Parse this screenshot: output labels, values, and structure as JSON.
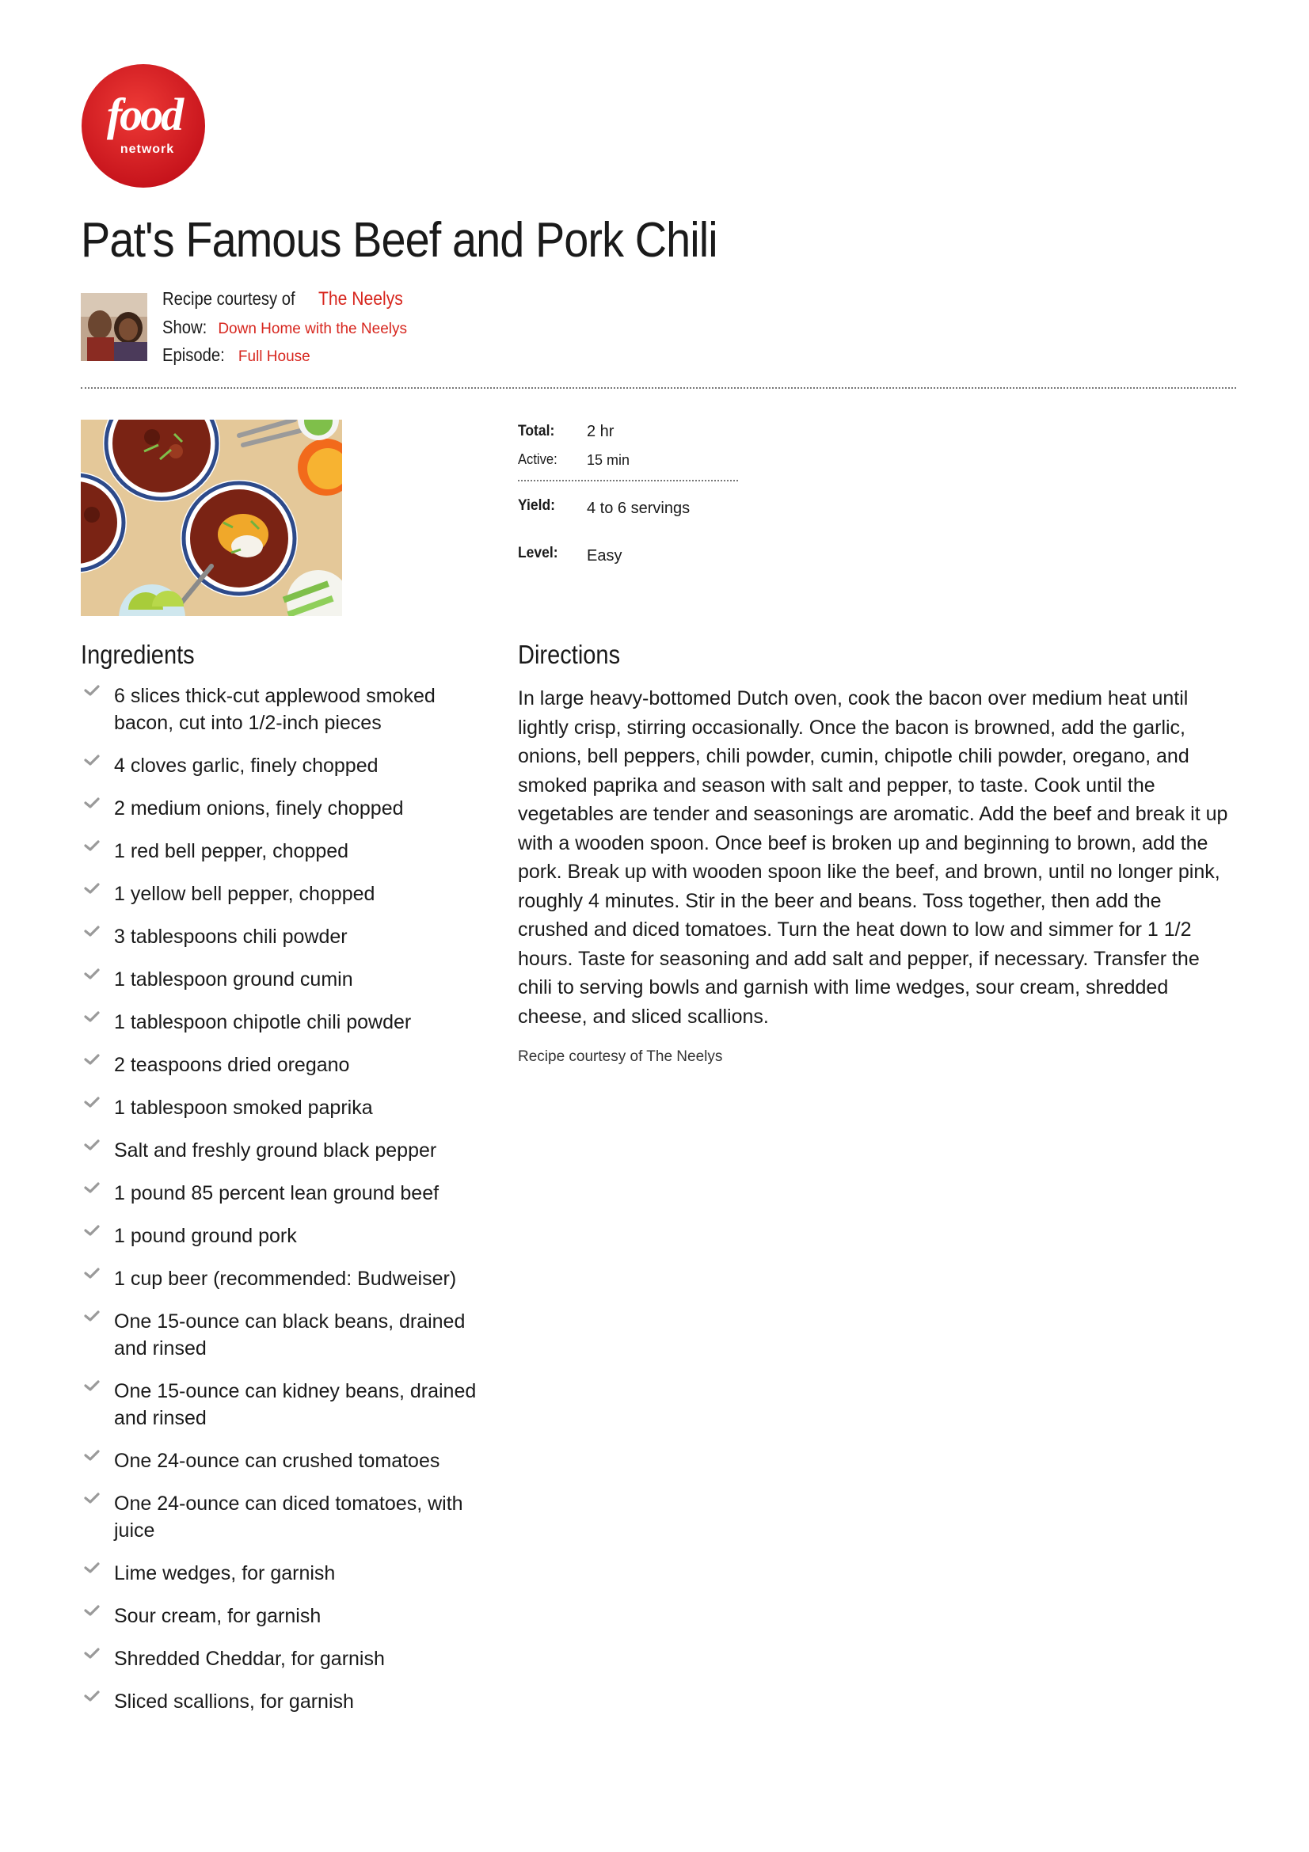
{
  "logo": {
    "brand": "food",
    "sub": "network",
    "color": "#d7261e"
  },
  "recipe": {
    "title": "Pat's Famous Beef and Pork Chili",
    "courtesy_label": "Recipe courtesy of",
    "courtesy_name": "The Neelys",
    "show_label": "Show:",
    "show_name": "Down Home with the Neelys",
    "episode_label": "Episode:",
    "episode_name": "Full House"
  },
  "meta": {
    "total_label": "Total:",
    "total_value": "2 hr",
    "active_label": "Active:",
    "active_value": "15 min",
    "yield_label": "Yield:",
    "yield_value": "4 to 6 servings",
    "level_label": "Level:",
    "level_value": "Easy"
  },
  "ingredients": {
    "heading": "Ingredients",
    "items": [
      "6 slices thick-cut applewood smoked bacon, cut into 1/2-inch pieces",
      "4 cloves garlic, finely chopped",
      "2 medium onions, finely chopped",
      "1 red bell pepper, chopped",
      "1 yellow bell pepper, chopped",
      "3 tablespoons chili powder",
      "1 tablespoon ground cumin",
      "1 tablespoon chipotle chili powder",
      "2 teaspoons dried oregano",
      "1 tablespoon smoked paprika",
      "Salt and freshly ground black pepper",
      "1 pound 85 percent lean ground beef",
      "1 pound ground pork",
      "1 cup beer (recommended: Budweiser)",
      "One 15-ounce can black beans, drained and rinsed",
      "One 15-ounce can kidney beans, drained and rinsed",
      "One 24-ounce can crushed tomatoes",
      "One 24-ounce can diced tomatoes, with juice",
      "Lime wedges, for garnish",
      "Sour cream, for garnish",
      "Shredded Cheddar, for garnish",
      "Sliced scallions, for garnish"
    ]
  },
  "directions": {
    "heading": "Directions",
    "text": "In large heavy-bottomed Dutch oven, cook the bacon over medium heat until lightly crisp, stirring occasionally. Once the bacon is browned, add the garlic, onions, bell peppers, chili powder, cumin, chipotle chili powder, oregano, and smoked paprika and season with salt and pepper, to taste. Cook until the vegetables are tender and seasonings are aromatic. Add the beef and break it up with a wooden spoon. Once beef is broken up and beginning to brown, add the pork. Break up with wooden spoon like the beef, and brown, until no longer pink, roughly 4 minutes. Stir in the beer and beans. Toss together, then add the crushed and diced tomatoes. Turn the heat down to low and simmer for 1 1/2 hours. Taste for seasoning and add salt and pepper, if necessary. Transfer the chili to serving bowls and garnish with lime wedges, sour cream, shredded cheese, and sliced scallions.",
    "courtesy_note": "Recipe courtesy of The Neelys"
  }
}
